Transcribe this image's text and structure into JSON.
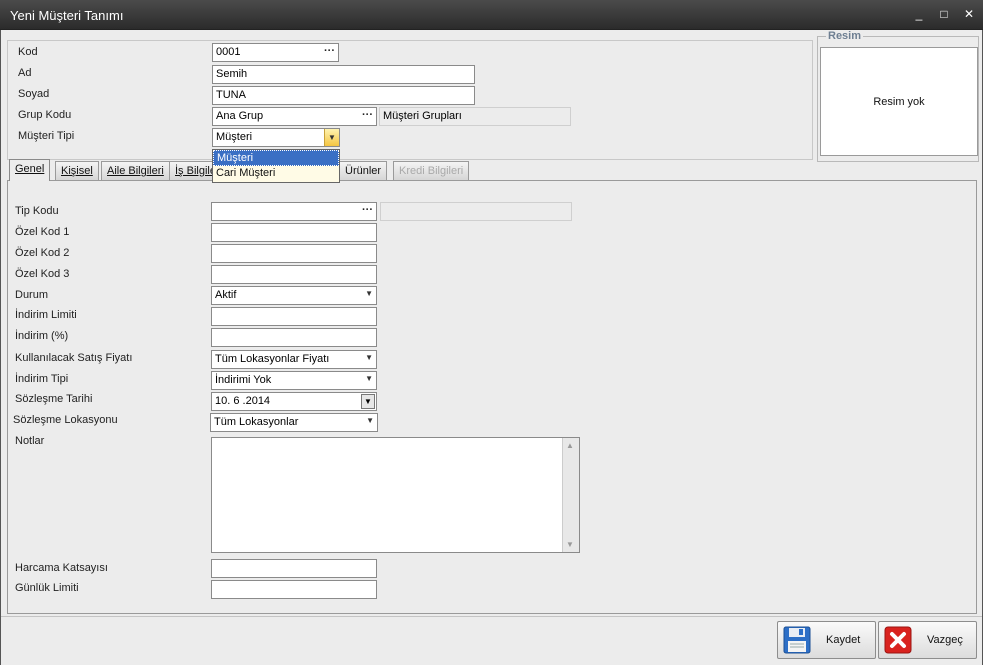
{
  "window": {
    "title": "Yeni Müşteri Tanımı",
    "min": "_",
    "max": "□",
    "close": "✕"
  },
  "top": {
    "kod_label": "Kod",
    "kod_value": "0001",
    "ad_label": "Ad",
    "ad_value": "Semih",
    "soyad_label": "Soyad",
    "soyad_value": "TUNA",
    "grup_label": "Grup Kodu",
    "grup_value": "Ana Grup",
    "grup_name": "Müşteri Grupları",
    "tip_label": "Müşteri Tipi",
    "tip_value": "Müşteri",
    "ellipsis": "···"
  },
  "dropdown": {
    "options": [
      "Müşteri",
      "Cari Müşteri"
    ],
    "selected": "Müşteri"
  },
  "resim": {
    "title": "Resim",
    "placeholder": "Resim yok"
  },
  "tabs": [
    {
      "label": "Genel",
      "active": true
    },
    {
      "label": "Kişisel"
    },
    {
      "label": "Aile Bilgileri"
    },
    {
      "label": "İş Bilgile"
    },
    {
      "label": "Ürünler"
    },
    {
      "label": "Kredi Bilgileri",
      "disabled": true
    }
  ],
  "genel": {
    "tip_kodu": "Tip Kodu",
    "ozel1": "Özel Kod 1",
    "ozel2": "Özel Kod 2",
    "ozel3": "Özel Kod 3",
    "durum_label": "Durum",
    "durum_value": "Aktif",
    "ind_limit": "İndirim Limiti",
    "ind_pct": "İndirim (%)",
    "fiyat_label": "Kullanılacak Satış Fiyatı",
    "fiyat_value": "Tüm Lokasyonlar Fiyatı",
    "ind_tipi_label": "İndirim Tipi",
    "ind_tipi_value": "İndirimi Yok",
    "sozlesme_tarihi_label": "Sözleşme Tarihi",
    "sozlesme_tarihi_value": "10. 6 .2014",
    "sozlesme_lok_label": "Sözleşme Lokasyonu",
    "sozlesme_lok_value": "Tüm Lokasyonlar",
    "notlar": "Notlar",
    "harcama": "Harcama Katsayısı",
    "gunluk": "Günlük Limiti"
  },
  "buttons": {
    "save": "Kaydet",
    "cancel": "Vazgeç"
  },
  "colors": {
    "title_bg": "#2b2b2b",
    "selection": "#3a6fc4",
    "combo_accent": "#f4c542"
  }
}
